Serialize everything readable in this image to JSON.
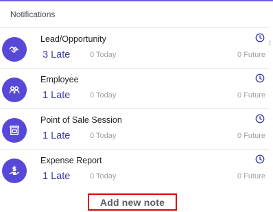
{
  "header": {
    "title": "Notifications"
  },
  "activities": [
    {
      "name": "Lead/Opportunity",
      "late": "3 Late",
      "today": "0 Today",
      "future": "0 Future",
      "icon": "handshake-icon"
    },
    {
      "name": "Employee",
      "late": "1 Late",
      "today": "0 Today",
      "future": "0 Future",
      "icon": "people-icon"
    },
    {
      "name": "Point of Sale Session",
      "late": "1 Late",
      "today": "0 Today",
      "future": "0 Future",
      "icon": "store-icon"
    },
    {
      "name": "Expense Report",
      "late": "1 Late",
      "today": "0 Today",
      "future": "0 Future",
      "icon": "money-hand-icon"
    }
  ],
  "footer": {
    "add_note_label": "Add new note"
  },
  "colors": {
    "accent": "#5848d8",
    "late_text": "#3b3fa8",
    "highlight_border": "#e00000"
  }
}
